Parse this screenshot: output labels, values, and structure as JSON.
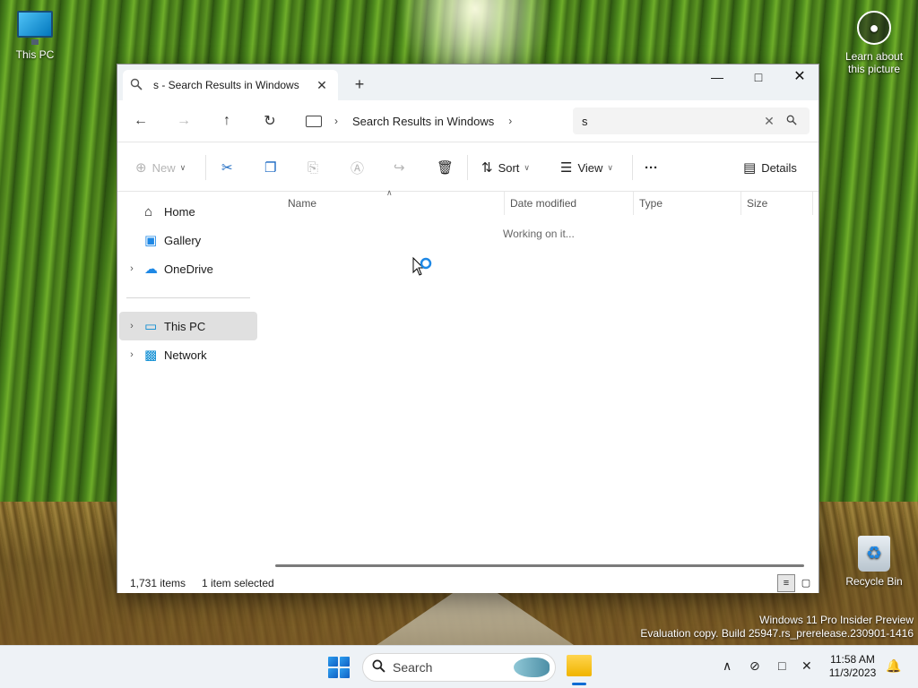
{
  "desktop": {
    "this_pc_label": "This PC",
    "recycle_bin_label": "Recycle Bin",
    "learn_line1": "Learn about",
    "learn_line2": "this picture",
    "watermark_line1": "Windows 11 Pro Insider Preview",
    "watermark_line2": "Evaluation copy. Build 25947.rs_prerelease.230901-1416"
  },
  "window": {
    "tab_title": "s - Search Results in Windows",
    "new_tab_symbol": "+",
    "address": {
      "location": "Search Results in Windows"
    },
    "search": {
      "query": "s"
    },
    "toolbar": {
      "new_label": "New",
      "sort_label": "Sort",
      "view_label": "View",
      "more_label": "···",
      "details_label": "Details"
    },
    "sidebar": {
      "items": [
        {
          "label": "Home",
          "icon": "home-icon"
        },
        {
          "label": "Gallery",
          "icon": "gallery-icon"
        },
        {
          "label": "OneDrive",
          "icon": "cloud-icon"
        },
        {
          "label": "This PC",
          "icon": "computer-icon"
        },
        {
          "label": "Network",
          "icon": "network-icon"
        }
      ]
    },
    "columns": [
      "Name",
      "Date modified",
      "Type",
      "Size"
    ],
    "working_text": "Working on it...",
    "status": {
      "item_count": "1,731 items",
      "selection": "1 item selected"
    }
  },
  "taskbar": {
    "search_placeholder": "Search",
    "time": "11:58 AM",
    "date": "11/3/2023"
  },
  "colors": {
    "accent": "#0067c0",
    "selected_nav": "#e0e0e0",
    "titlebar": "#eef2f5",
    "taskbar": "#eef2f6"
  }
}
